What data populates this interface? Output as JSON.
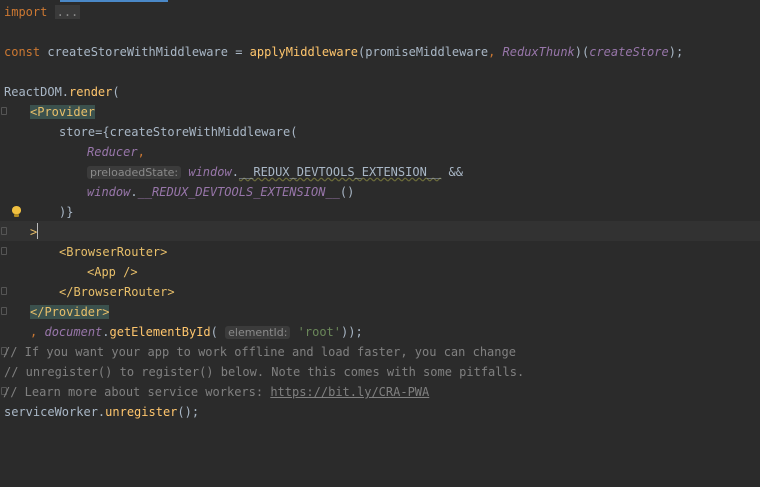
{
  "editor": {
    "line_import": {
      "kw": "import",
      "folded": "..."
    },
    "line_const": {
      "kw": "const",
      "name": " createStoreWithMiddleware = ",
      "fn": "applyMiddleware",
      "open": "(promiseMiddleware",
      "comma": ",",
      "arg2": "ReduxThunk",
      "mid": ")(",
      "arg3": "createStore",
      "close": ");"
    },
    "line_render": {
      "obj": "ReactDOM.",
      "fn": "render",
      "open": "("
    },
    "line_provider_open": "<Provider",
    "line_store": {
      "prop": "store={createStoreWithMiddleware("
    },
    "line_reducer": {
      "arg": "Reducer",
      "comma": ","
    },
    "line_devtools": {
      "hint": "preloadedState:",
      "obj": "window",
      "dot": ".",
      "prop": "__REDUX_DEVTOOLS_EXTENSION__",
      "op": " &&"
    },
    "line_devtools_call": {
      "obj": "window",
      "dot": ".",
      "prop": "__REDUX_DEVTOOLS_EXTENSION__",
      "call": "()"
    },
    "line_close_paren": ")}",
    "line_gt": ">",
    "line_router_open": "<BrowserRouter>",
    "line_app": "<App />",
    "line_router_close": "</BrowserRouter>",
    "line_provider_close": "</Provider>",
    "line_getel": {
      "comma": ",",
      "obj": "document",
      "dot": ".",
      "fn": "getElementById",
      "open": "(",
      "hint": "elementId:",
      "str": "'root'",
      "close": "));"
    },
    "comment1": "// If you want your app to work offline and load faster, you can change",
    "comment2": "// unregister() to register() below. Note this comes with some pitfalls.",
    "comment3_prefix": "// Learn more about service workers: ",
    "comment3_link": "https://bit.ly/CRA-PWA",
    "line_sw": {
      "obj": "serviceWorker.",
      "fn": "unregister",
      "close": "();"
    }
  },
  "colors": {
    "background": "#2b2b2b",
    "keyword": "#cc7832",
    "function": "#ffc66d",
    "field": "#9876aa",
    "string": "#6a8759",
    "comment": "#808080",
    "tag": "#e8bf6a"
  },
  "icons": {
    "gutter": [
      "lightbulb-icon",
      "fold-marker-icon"
    ]
  }
}
